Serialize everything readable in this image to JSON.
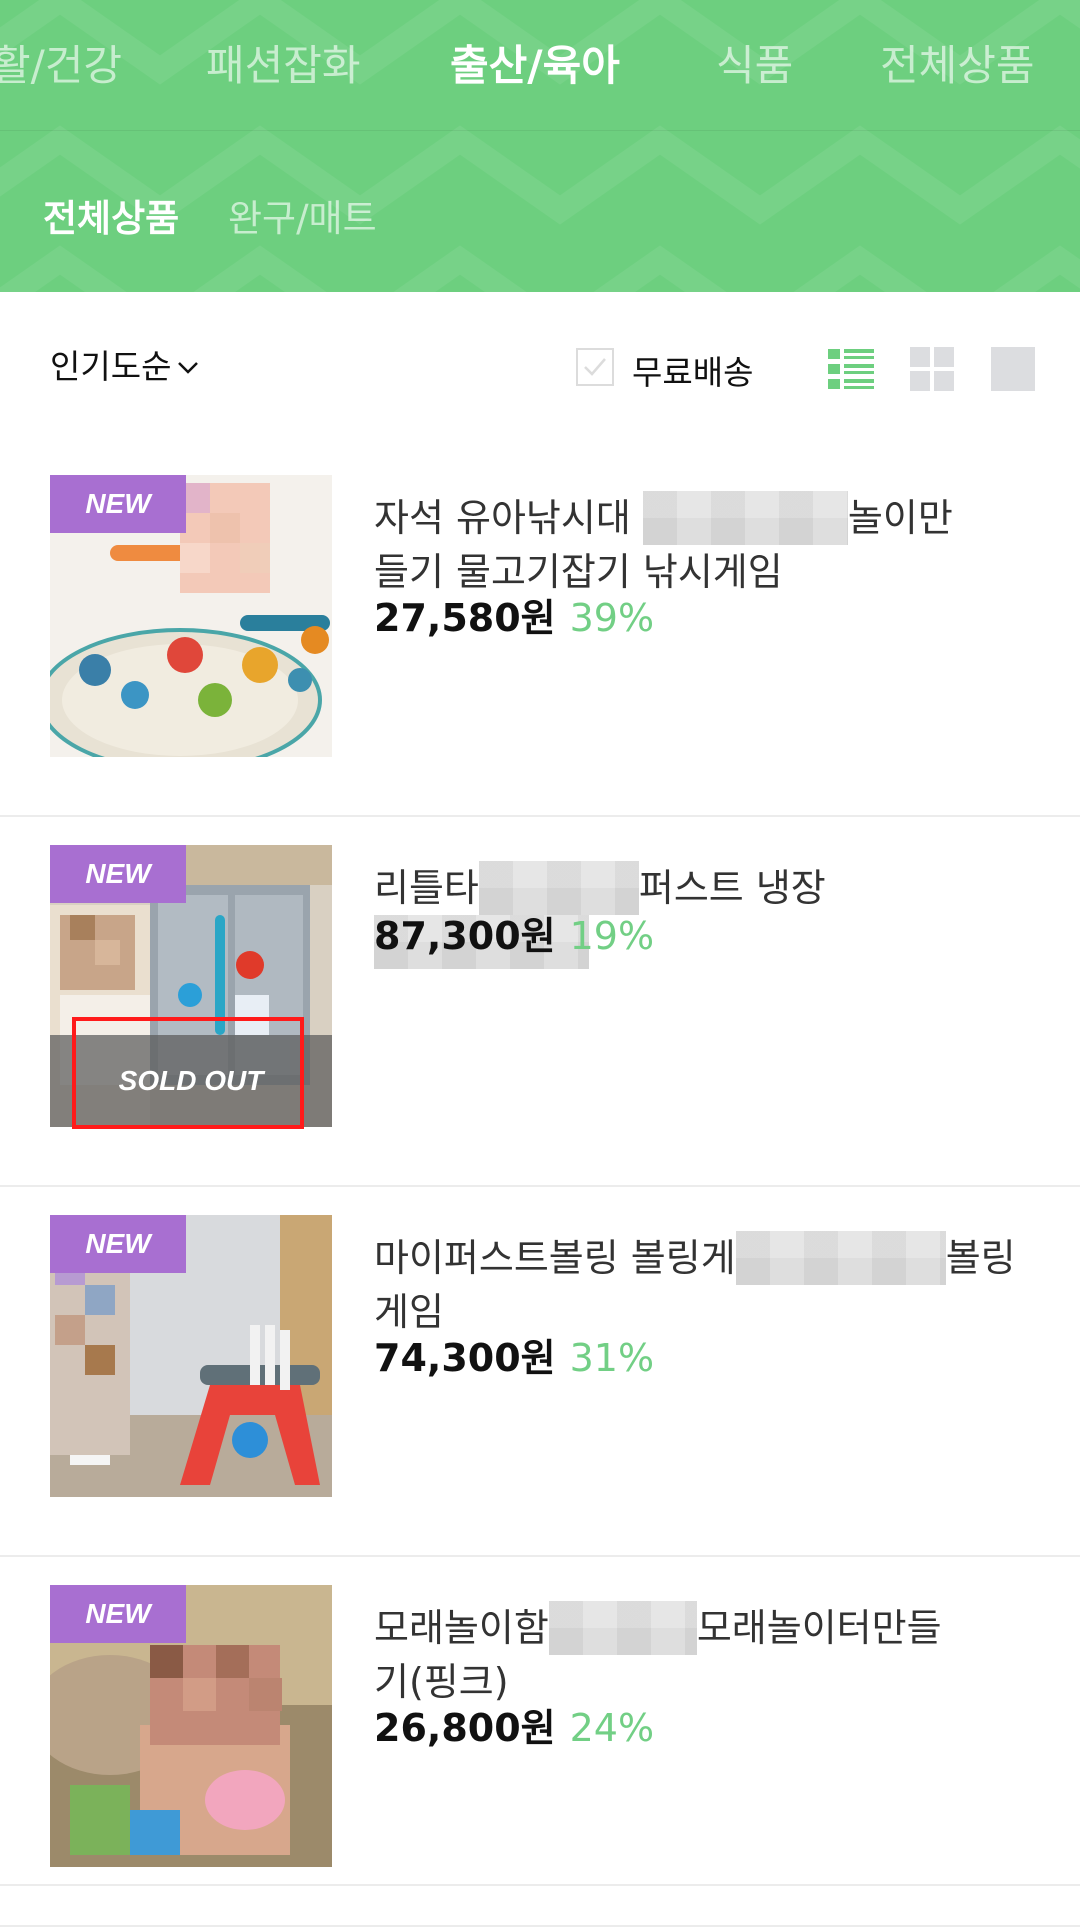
{
  "colors": {
    "header_bg": "#6dcf7f",
    "accent_green": "#72cf85",
    "new_badge": "#a86fd1",
    "highlight_red": "#ff1a1a"
  },
  "category_tabs": [
    "활/건강",
    "패션잡화",
    "출산/육아",
    "식품",
    "전체상품"
  ],
  "active_category": "출산/육아",
  "sub_tabs": [
    "전체상품",
    "완구/매트"
  ],
  "active_sub_tab": "전체상품",
  "toolbar": {
    "sort_label": "인기도순",
    "free_shipping_label": "무료배송",
    "free_shipping_checked": false,
    "view_modes": [
      "list-view-icon",
      "grid-view-icon",
      "single-view-icon"
    ],
    "active_view": "list-view-icon"
  },
  "products": [
    {
      "badge": "NEW",
      "title_a": "자석 유아낚시대",
      "title_b": "놀이만",
      "title_c": "들기 물고기잡기 낚시게임",
      "price": "27,580원",
      "discount": "39%",
      "sold_out": false
    },
    {
      "badge": "NEW",
      "title_a": "리틀타",
      "title_b": "퍼스트 냉장",
      "title_c": "",
      "price": "87,300원",
      "discount": "19%",
      "sold_out": true,
      "sold_out_label": "SOLD OUT"
    },
    {
      "badge": "NEW",
      "title_a": "마이퍼스트볼링 볼링게",
      "title_b": "볼링",
      "title_c": "게임",
      "price": "74,300원",
      "discount": "31%",
      "sold_out": false
    },
    {
      "badge": "NEW",
      "title_a": "모래놀이함",
      "title_b": "모래놀이터만들",
      "title_c": "기(핑크)",
      "price": "26,800원",
      "discount": "24%",
      "sold_out": false
    }
  ]
}
